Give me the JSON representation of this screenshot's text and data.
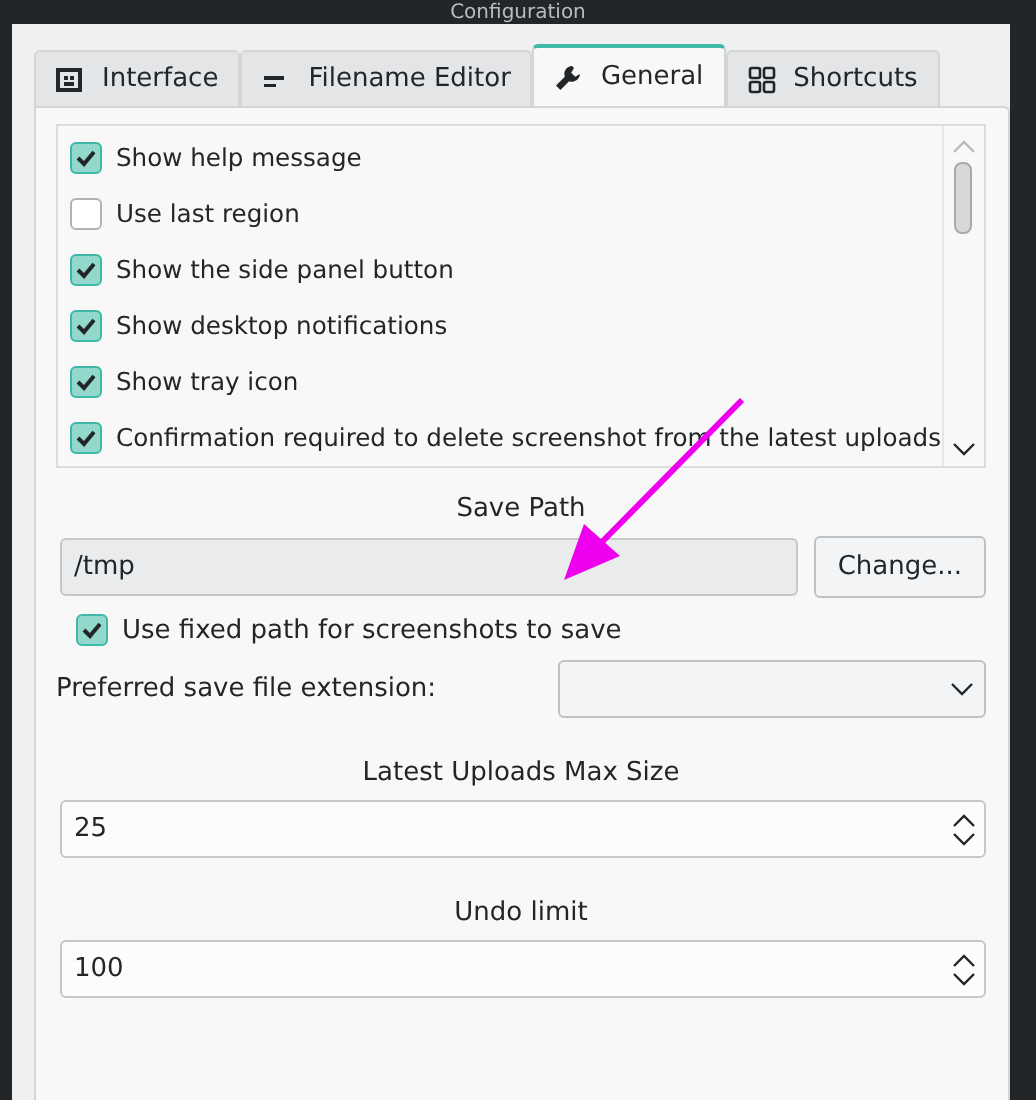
{
  "window": {
    "title": "Configuration"
  },
  "tabs": [
    {
      "label": "Interface",
      "kind": "panel",
      "selected": false
    },
    {
      "label": "Filename Editor",
      "kind": "dash",
      "selected": false
    },
    {
      "label": "General",
      "kind": "wrench",
      "selected": true
    },
    {
      "label": "Shortcuts",
      "kind": "grid",
      "selected": false
    }
  ],
  "options": [
    {
      "label": "Show help message",
      "checked": true
    },
    {
      "label": "Use last region",
      "checked": false
    },
    {
      "label": "Show the side panel button",
      "checked": true
    },
    {
      "label": "Show desktop notifications",
      "checked": true
    },
    {
      "label": "Show tray icon",
      "checked": true
    },
    {
      "label": "Confirmation required to delete screenshot from the latest uploads",
      "checked": true
    }
  ],
  "save_path": {
    "heading": "Save Path",
    "value": "/tmp",
    "button": "Change..."
  },
  "fixed_path": {
    "label": "Use fixed path for screenshots to save",
    "checked": true
  },
  "extension": {
    "label": "Preferred save file extension:"
  },
  "uploads_max": {
    "heading": "Latest Uploads Max Size",
    "value": "25"
  },
  "undo_limit": {
    "heading": "Undo limit",
    "value": "100"
  }
}
